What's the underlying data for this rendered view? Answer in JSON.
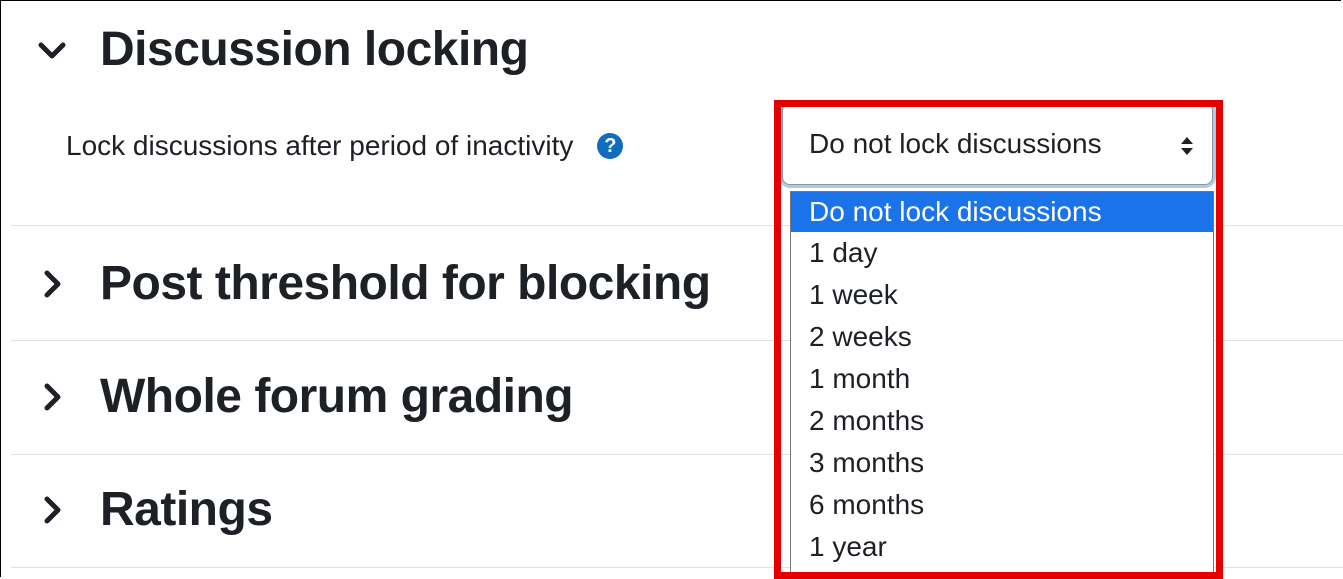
{
  "sections": [
    {
      "title": "Discussion locking",
      "expanded": true
    },
    {
      "title": "Post threshold for blocking",
      "expanded": false
    },
    {
      "title": "Whole forum grading",
      "expanded": false
    },
    {
      "title": "Ratings",
      "expanded": false
    }
  ],
  "field": {
    "label": "Lock discussions after period of inactivity",
    "help_icon": "?",
    "selected_value": "Do not lock discussions",
    "options": [
      "Do not lock discussions",
      "1 day",
      "1 week",
      "2 weeks",
      "1 month",
      "2 months",
      "3 months",
      "6 months",
      "1 year"
    ]
  },
  "colors": {
    "highlight_box": "#e40000",
    "selected_option_bg": "#1a73e8",
    "help_icon_bg": "#0f6cbf"
  }
}
